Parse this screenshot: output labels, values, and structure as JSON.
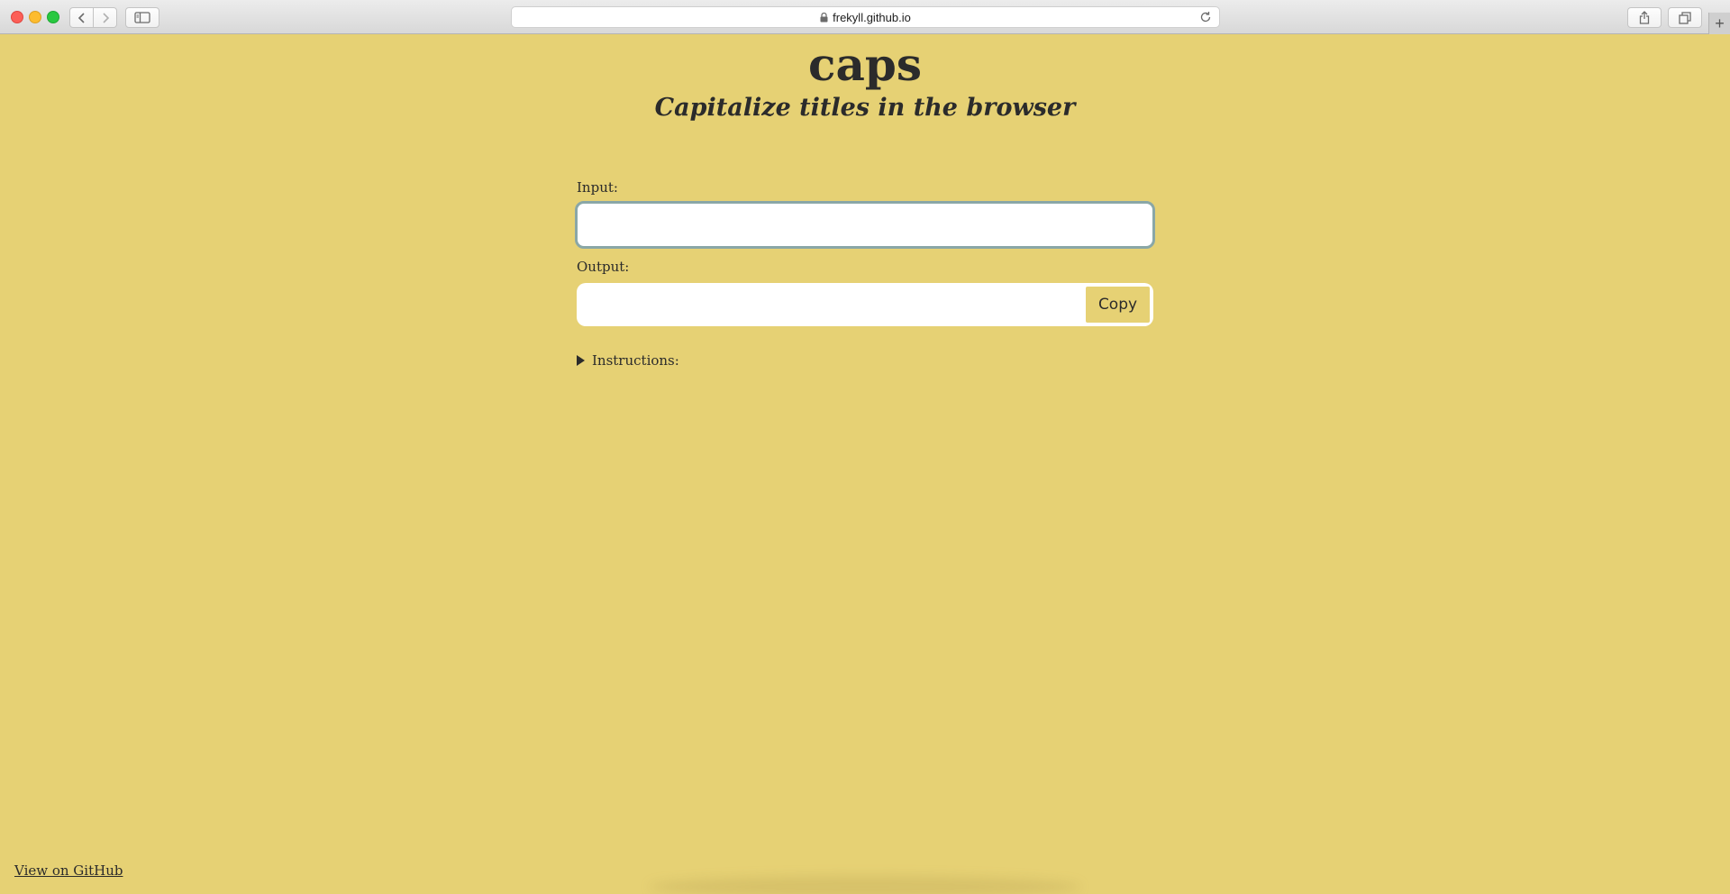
{
  "browser": {
    "url": "frekyll.github.io",
    "icons": {
      "back": "chevron-left-icon",
      "forward": "chevron-right-icon",
      "sidebar": "sidebar-icon",
      "lock": "lock-icon",
      "reload": "reload-icon",
      "share": "share-icon",
      "tabs": "tabs-icon",
      "new_tab": "plus-icon"
    },
    "new_tab_label": "+"
  },
  "header": {
    "title": "caps",
    "subtitle": "Capitalize titles in the browser"
  },
  "form": {
    "input_label": "Input:",
    "input_value": "",
    "output_label": "Output:",
    "output_value": "",
    "copy_label": "Copy"
  },
  "instructions": {
    "label": "Instructions:",
    "icon": "disclosure-triangle-icon"
  },
  "footer": {
    "github_link": "View on GitHub"
  },
  "colors": {
    "background": "#e6d174",
    "text": "#2b2b2b",
    "input_border": "#8aa7a7"
  }
}
